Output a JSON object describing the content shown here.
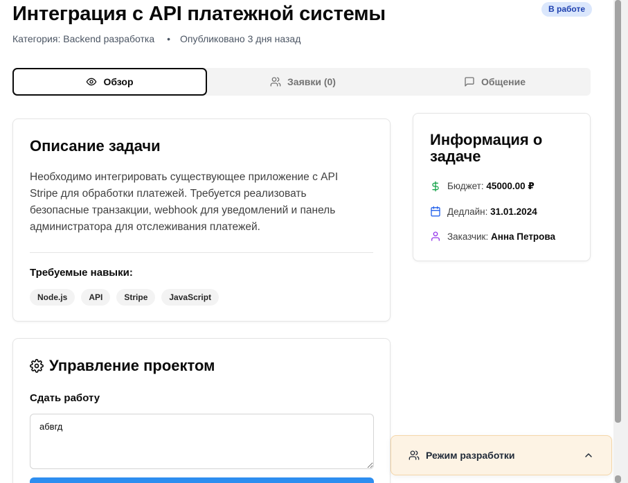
{
  "header": {
    "title": "Интеграция с API платежной системы",
    "status": "В работе",
    "category": "Категория: Backend разработка",
    "separator": "•",
    "published": "Опубликовано 3 дня назад"
  },
  "tabs": [
    {
      "label": "Обзор",
      "icon": "eye-icon",
      "active": true
    },
    {
      "label": "Заявки (0)",
      "icon": "users-icon",
      "active": false
    },
    {
      "label": "Общение",
      "icon": "message-icon",
      "active": false
    }
  ],
  "description": {
    "title": "Описание задачи",
    "text": "Необходимо интегрировать существующее приложение с API Stripe для обработки платежей. Требуется реализовать безопасные транзакции, webhook для уведомлений и панель администратора для отслеживания платежей.",
    "skills_label": "Требуемые навыки:",
    "skills": [
      "Node.js",
      "API",
      "Stripe",
      "JavaScript"
    ]
  },
  "info": {
    "title": "Информация о задаче",
    "budget_label": "Бюджет:",
    "budget_value": "45000.00 ₽",
    "deadline_label": "Дедлайн:",
    "deadline_value": "31.01.2024",
    "client_label": "Заказчик:",
    "client_value": "Анна Петрова"
  },
  "management": {
    "title": "Управление проектом",
    "submit_label": "Сдать работу",
    "submit_value": "абвгд"
  },
  "dev_panel": {
    "label": "Режим разработки"
  },
  "colors": {
    "accent_blue": "#2d8ef0",
    "badge_bg": "#dbe7fc",
    "budget_green": "#16a34a",
    "deadline_blue": "#2563eb",
    "client_purple": "#9333ea",
    "dev_panel_bg": "#fdf3e4"
  }
}
